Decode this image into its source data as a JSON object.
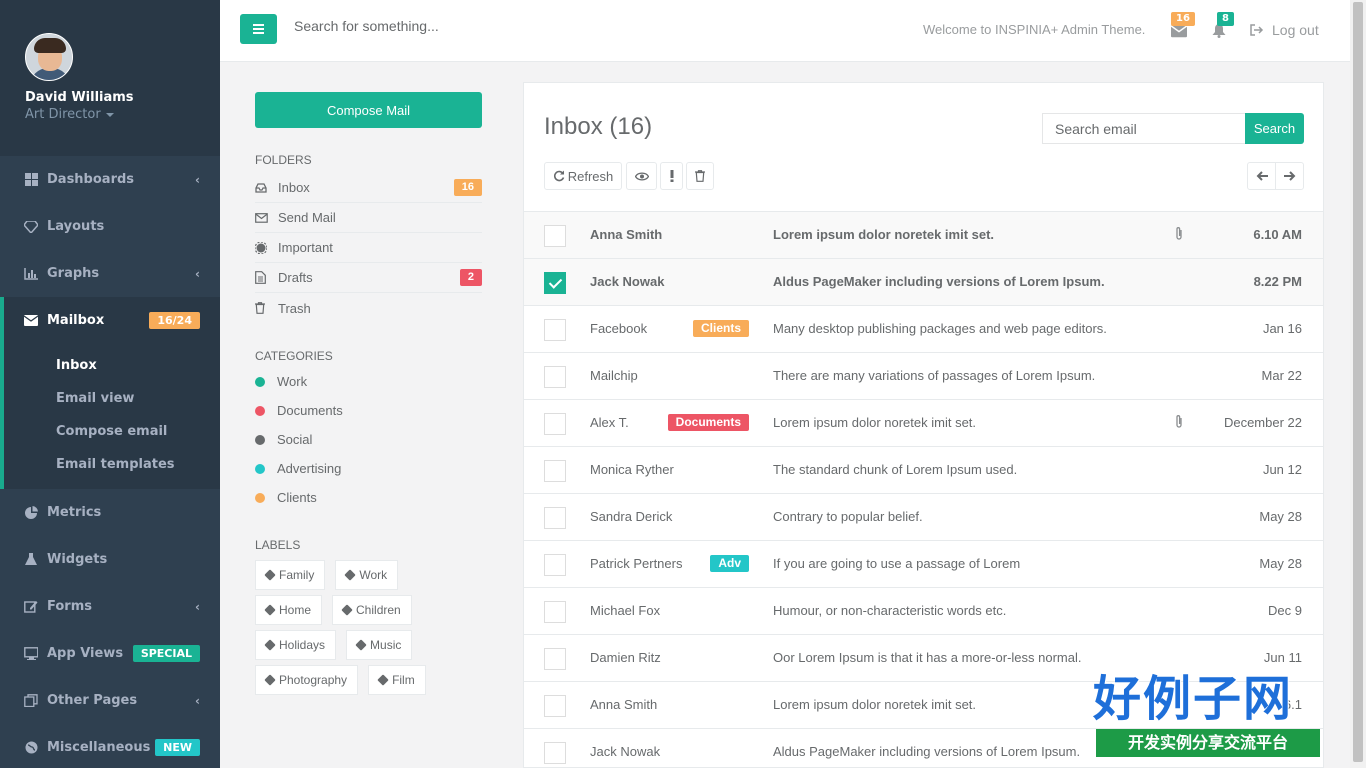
{
  "profile": {
    "name": "David Williams",
    "role": "Art Director"
  },
  "nav": [
    {
      "label": "Dashboards",
      "icon": "th-large-icon",
      "arrow": "‹"
    },
    {
      "label": "Layouts",
      "icon": "diamond-icon"
    },
    {
      "label": "Graphs",
      "icon": "bar-chart-icon",
      "arrow": "‹"
    },
    {
      "label": "Mailbox",
      "icon": "envelope-icon",
      "badge": "16/24"
    },
    {
      "label": "Metrics",
      "icon": "pie-chart-icon"
    },
    {
      "label": "Widgets",
      "icon": "flask-icon"
    },
    {
      "label": "Forms",
      "icon": "edit-icon",
      "arrow": "‹"
    },
    {
      "label": "App Views",
      "icon": "desktop-icon",
      "badge": "SPECIAL"
    },
    {
      "label": "Other Pages",
      "icon": "files-icon",
      "arrow": "‹"
    },
    {
      "label": "Miscellaneous",
      "icon": "globe-icon",
      "badge": "NEW"
    }
  ],
  "mailbox_sub": [
    "Inbox",
    "Email view",
    "Compose email",
    "Email templates"
  ],
  "topbar": {
    "search_placeholder": "Search for something...",
    "welcome": "Welcome to INSPINIA+ Admin Theme.",
    "mail_count": "16",
    "bell_count": "8",
    "logout": "Log out"
  },
  "left": {
    "compose": "Compose Mail",
    "folders_title": "FOLDERS",
    "folders": [
      {
        "label": "Inbox",
        "badge": "16",
        "color": "#f8ac59"
      },
      {
        "label": "Send Mail"
      },
      {
        "label": "Important"
      },
      {
        "label": "Drafts",
        "badge": "2",
        "color": "#ed5565"
      },
      {
        "label": "Trash"
      }
    ],
    "categories_title": "CATEGORIES",
    "categories": [
      {
        "label": "Work",
        "color": "#1ab394"
      },
      {
        "label": "Documents",
        "color": "#ed5565"
      },
      {
        "label": "Social",
        "color": "#676a6c"
      },
      {
        "label": "Advertising",
        "color": "#23c6c8"
      },
      {
        "label": "Clients",
        "color": "#f8ac59"
      }
    ],
    "labels_title": "LABELS",
    "labels": [
      "Family",
      "Work",
      "Home",
      "Children",
      "Holidays",
      "Music",
      "Photography",
      "Film"
    ]
  },
  "inbox": {
    "title": "Inbox (16)",
    "search_placeholder": "Search email",
    "search_button": "Search",
    "refresh": "Refresh",
    "rows": [
      {
        "sender": "Anna Smith",
        "subject": "Lorem ipsum dolor noretek imit set.",
        "time": "6.10 AM",
        "unread": true,
        "clip": true
      },
      {
        "sender": "Jack Nowak",
        "subject": "Aldus PageMaker including versions of Lorem Ipsum.",
        "time": "8.22 PM",
        "unread": true,
        "checked": true
      },
      {
        "sender": "Facebook",
        "label": "Clients",
        "label_color": "#f8ac59",
        "subject": "Many desktop publishing packages and web page editors.",
        "time": "Jan 16"
      },
      {
        "sender": "Mailchip",
        "subject": "There are many variations of passages of Lorem Ipsum.",
        "time": "Mar 22"
      },
      {
        "sender": "Alex T.",
        "label": "Documents",
        "label_color": "#ed5565",
        "subject": "Lorem ipsum dolor noretek imit set.",
        "time": "December 22",
        "clip": true
      },
      {
        "sender": "Monica Ryther",
        "subject": "The standard chunk of Lorem Ipsum used.",
        "time": "Jun 12"
      },
      {
        "sender": "Sandra Derick",
        "subject": "Contrary to popular belief.",
        "time": "May 28"
      },
      {
        "sender": "Patrick Pertners",
        "label": "Adv",
        "label_color": "#23c6c8",
        "subject": "If you are going to use a passage of Lorem",
        "time": "May 28"
      },
      {
        "sender": "Michael Fox",
        "subject": "Humour, or non-characteristic words etc.",
        "time": "Dec 9"
      },
      {
        "sender": "Damien Ritz",
        "subject": "Oor Lorem Ipsum is that it has a more-or-less normal.",
        "time": "Jun 11"
      },
      {
        "sender": "Anna Smith",
        "subject": "Lorem ipsum dolor noretek imit set.",
        "time": "6.1"
      },
      {
        "sender": "Jack Nowak",
        "subject": "Aldus PageMaker including versions of Lorem Ipsum.",
        "time": ""
      }
    ]
  },
  "watermark": {
    "line1": "好例子网",
    "line2": "开发实例分享交流平台"
  }
}
